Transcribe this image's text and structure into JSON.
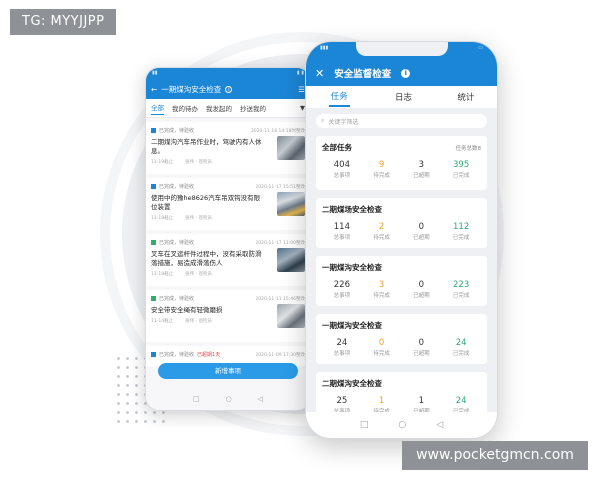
{
  "watermarks": {
    "top_left": "TG: MYYJJPP",
    "bottom_right": "www.pocketgmcn.com"
  },
  "back_phone": {
    "title": "一期煤沟安全检查",
    "tabs": [
      "全部",
      "我的待办",
      "我发起的",
      "抄送我的"
    ],
    "cards": [
      {
        "status": "已完成，待验收",
        "time": "2020-11-18 14:18时整改",
        "text": "二期煤沟汽车吊作业时，驾驶内有人休息。",
        "deadline": "11-19截止",
        "owner": "张伟 - 巡检员"
      },
      {
        "status": "已完成，待验收",
        "time": "2020-11-17 15:51整改",
        "text": "使用中的豫he8626汽车吊双钩没有限位装置",
        "deadline": "11-18截止",
        "owner": "张伟 - 巡检员"
      },
      {
        "status": "已完成，待验收",
        "time": "2020-11-17 11:00整改",
        "text": "叉车在叉运杆件过程中，没有采取防滑落措施，易造成滑落伤人",
        "deadline": "11-18截止",
        "owner": "张伟 - 巡检员"
      },
      {
        "status": "已完成，待验收",
        "time": "2020-11-11 15:46整改",
        "text": "安全带安全绳有轻微磨损",
        "deadline": "11-14截止",
        "owner": "张伟 - 巡检员"
      },
      {
        "status": "已完成，待验收",
        "extra": "已超期1天",
        "time": "2020-11-09 17:30整改"
      }
    ],
    "button": "新增事项",
    "nav": [
      "□",
      "○",
      "◁"
    ]
  },
  "front_phone": {
    "title": "安全监督检查",
    "tabs": [
      "任务",
      "日志",
      "统计"
    ],
    "search_placeholder": "关键字筛选",
    "cards": [
      {
        "title": "全部任务",
        "link": "任务总数8",
        "stats": [
          {
            "n": "404",
            "l": "总事项"
          },
          {
            "n": "9",
            "l": "待完成"
          },
          {
            "n": "3",
            "l": "已超期"
          },
          {
            "n": "395",
            "l": "已完成"
          }
        ]
      },
      {
        "title": "二期煤场安全检查",
        "stats": [
          {
            "n": "114",
            "l": "总事项"
          },
          {
            "n": "2",
            "l": "待完成"
          },
          {
            "n": "0",
            "l": "已超期"
          },
          {
            "n": "112",
            "l": "已完成"
          }
        ]
      },
      {
        "title": "一期煤沟安全检查",
        "stats": [
          {
            "n": "226",
            "l": "总事项"
          },
          {
            "n": "3",
            "l": "待完成"
          },
          {
            "n": "0",
            "l": "已超期"
          },
          {
            "n": "223",
            "l": "已完成"
          }
        ]
      },
      {
        "title": "一期煤沟安全检查",
        "stats": [
          {
            "n": "24",
            "l": "总事项"
          },
          {
            "n": "0",
            "l": "待完成"
          },
          {
            "n": "0",
            "l": "已超期"
          },
          {
            "n": "24",
            "l": "已完成"
          }
        ]
      },
      {
        "title": "二期煤沟安全检查",
        "stats": [
          {
            "n": "25",
            "l": "总事项"
          },
          {
            "n": "1",
            "l": "待完成"
          },
          {
            "n": "1",
            "l": "已超期"
          },
          {
            "n": "24",
            "l": "已完成"
          }
        ]
      }
    ],
    "nav": [
      "□",
      "○",
      "◁"
    ]
  },
  "colors": {
    "primary": "#1c86d6",
    "orange": "#e9a224",
    "green": "#2aa874",
    "button": "#2b9be8"
  },
  "icons": {
    "back": "back-arrow-icon",
    "close": "close-icon",
    "info": "info-icon",
    "search": "search-icon",
    "filter": "filter-icon",
    "menu": "menu-icon"
  }
}
